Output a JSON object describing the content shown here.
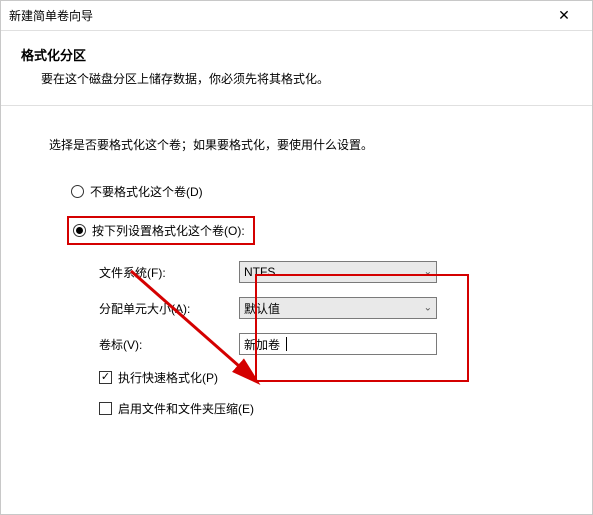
{
  "window": {
    "title": "新建简单卷向导",
    "close": "✕"
  },
  "header": {
    "title": "格式化分区",
    "desc": "要在这个磁盘分区上储存数据，你必须先将其格式化。"
  },
  "content": {
    "intro": "选择是否要格式化这个卷；如果要格式化，要使用什么设置。",
    "radio_no_format": "不要格式化这个卷(D)",
    "radio_format": "按下列设置格式化这个卷(O):",
    "fs_label": "文件系统(F):",
    "fs_value": "NTFS",
    "alloc_label": "分配单元大小(A):",
    "alloc_value": "默认值",
    "vol_label": "卷标(V):",
    "vol_value": "新加卷",
    "chk_quick": "执行快速格式化(P)",
    "chk_compress": "启用文件和文件夹压缩(E)"
  }
}
